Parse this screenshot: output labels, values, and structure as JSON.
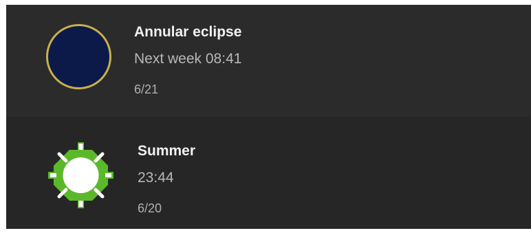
{
  "items": [
    {
      "icon": "annular-eclipse-icon",
      "title": "Annular eclipse",
      "subtitle": "Next week 08:41",
      "date": "6/21"
    },
    {
      "icon": "summer-sun-icon",
      "title": "Summer",
      "subtitle": "23:44",
      "date": "6/20"
    }
  ],
  "colors": {
    "panel_background": "#2b2b2b",
    "eclipse_fill": "#0c1a4a",
    "eclipse_ring": "#c9b04a",
    "sun_green": "#5cb82b",
    "sun_core": "#ffffff"
  }
}
